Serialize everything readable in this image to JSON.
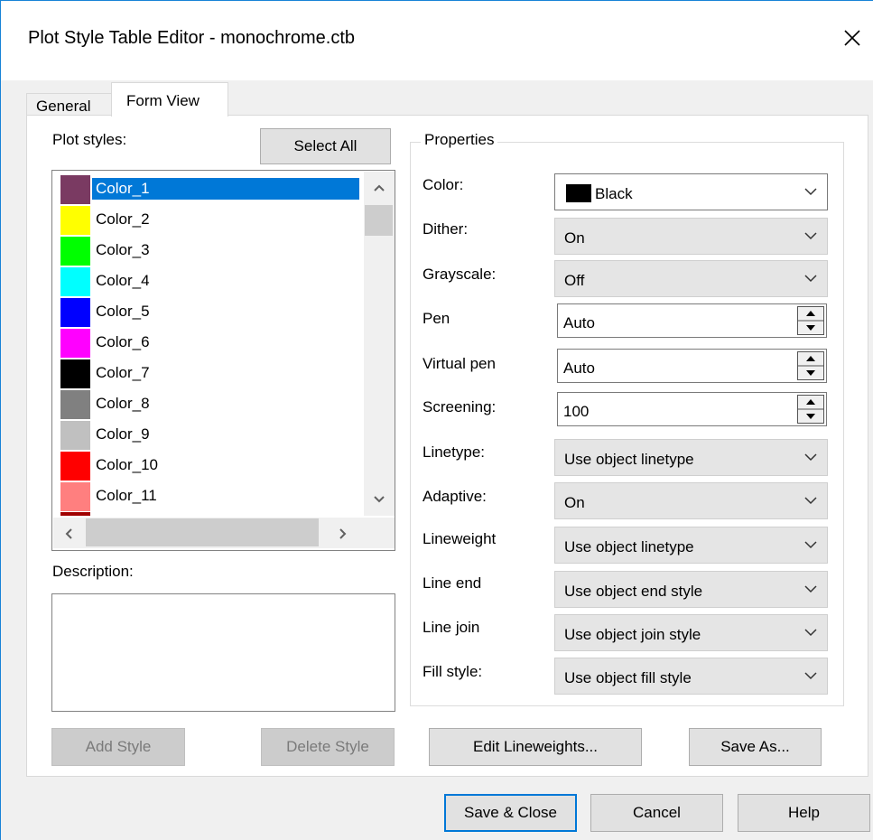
{
  "window": {
    "title": "Plot Style Table Editor - monochrome.ctb"
  },
  "tabs": [
    {
      "label": "General"
    },
    {
      "label": "Form View"
    }
  ],
  "plot_styles": {
    "label": "Plot styles:",
    "select_all": "Select All",
    "items": [
      {
        "label": "Color_1",
        "color": "#7a3a62"
      },
      {
        "label": "Color_2",
        "color": "#ffff00"
      },
      {
        "label": "Color_3",
        "color": "#00ff00"
      },
      {
        "label": "Color_4",
        "color": "#00ffff"
      },
      {
        "label": "Color_5",
        "color": "#0000ff"
      },
      {
        "label": "Color_6",
        "color": "#ff00ff"
      },
      {
        "label": "Color_7",
        "color": "#000000"
      },
      {
        "label": "Color_8",
        "color": "#808080"
      },
      {
        "label": "Color_9",
        "color": "#c0c0c0"
      },
      {
        "label": "Color_10",
        "color": "#ff0000"
      },
      {
        "label": "Color_11",
        "color": "#ff7f7f"
      }
    ]
  },
  "description": {
    "label": "Description:"
  },
  "properties": {
    "legend": "Properties",
    "color": {
      "label": "Color:",
      "value": "Black"
    },
    "dither": {
      "label": "Dither:",
      "value": "On"
    },
    "grayscale": {
      "label": "Grayscale:",
      "value": "Off"
    },
    "pen": {
      "label": "Pen",
      "value": "Auto"
    },
    "virtual_pen": {
      "label": "Virtual pen",
      "value": "Auto"
    },
    "screening": {
      "label": "Screening:",
      "value": "100"
    },
    "linetype": {
      "label": "Linetype:",
      "value": "Use object linetype"
    },
    "adaptive": {
      "label": "Adaptive:",
      "value": "On"
    },
    "lineweight": {
      "label": "Lineweight",
      "value": "Use object linetype"
    },
    "line_end": {
      "label": "Line end",
      "value": "Use object end style"
    },
    "line_join": {
      "label": "Line join",
      "value": "Use object join style"
    },
    "fill_style": {
      "label": "Fill style:",
      "value": "Use object fill style"
    }
  },
  "buttons": {
    "add_style": "Add Style",
    "delete_style": "Delete Style",
    "edit_lineweights": "Edit Lineweights...",
    "save_as": "Save As...",
    "save_close": "Save & Close",
    "cancel": "Cancel",
    "help": "Help"
  }
}
